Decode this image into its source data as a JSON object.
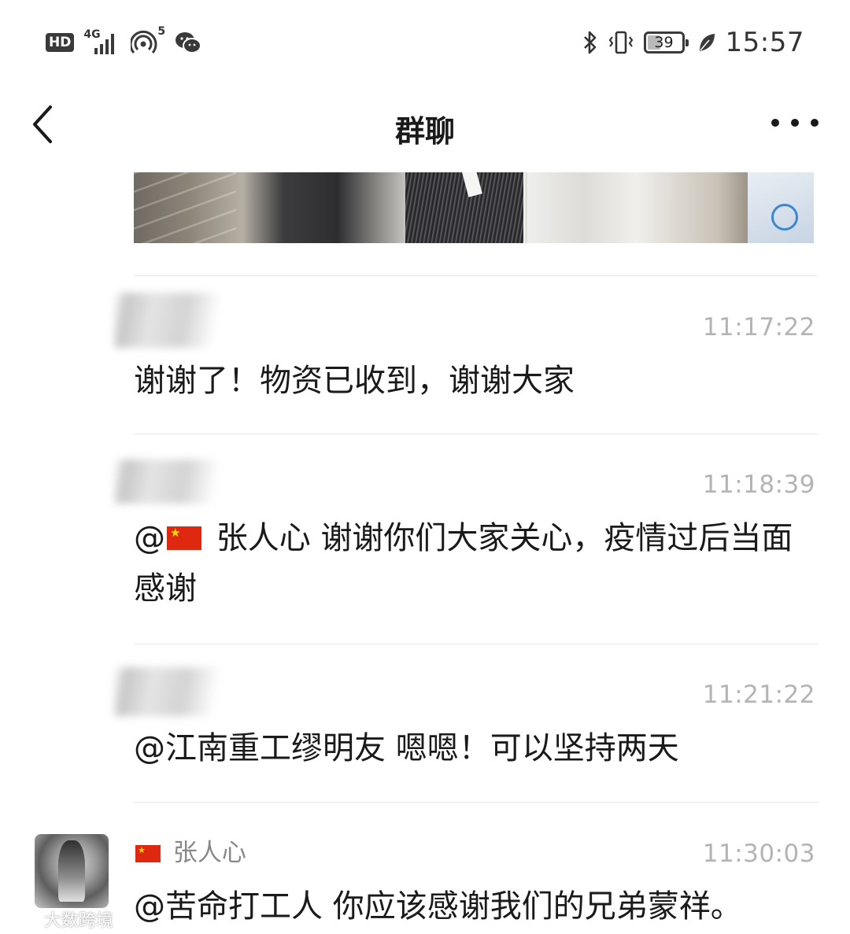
{
  "status_bar": {
    "hd_badge": "HD",
    "network_type": "4G",
    "hotspot_count": "5",
    "battery_level": "39",
    "battery_fraction": 0.39,
    "time": "15:57",
    "icons": [
      "signal-bars-icon",
      "hotspot-icon",
      "wechat-icon",
      "bluetooth-icon",
      "vibrate-icon",
      "battery-icon",
      "eco-leaf-icon"
    ]
  },
  "nav": {
    "title": "群聊",
    "back_icon": "chevron-left-icon",
    "more_icon": "more-dots-icon"
  },
  "messages": [
    {
      "time": "11:17:22",
      "text": "谢谢了！物资已收到，谢谢大家"
    },
    {
      "time": "11:18:39",
      "mention": "@",
      "mention_name": "张人心",
      "text": "谢谢你们大家关心，疫情过后当面感谢"
    },
    {
      "time": "11:21:22",
      "text": "@江南重工缪明友 嗯嗯！可以坚持两天"
    },
    {
      "time": "11:30:03",
      "sender": "张人心",
      "text": "@苦命打工人 你应该感谢我们的兄弟蒙祥。"
    }
  ],
  "watermark": {
    "text": "大数跨境",
    "logo": "weibo-logo"
  }
}
